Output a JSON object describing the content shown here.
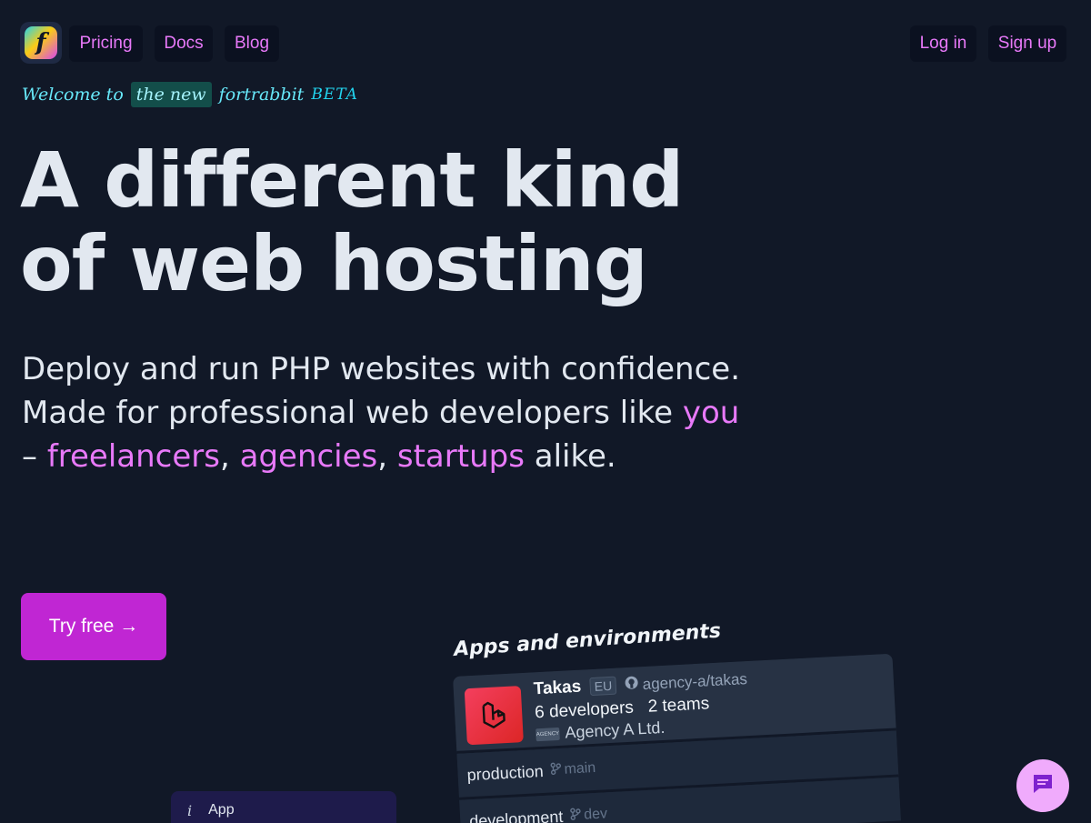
{
  "header": {
    "logo_letter": "f",
    "nav": [
      "Pricing",
      "Docs",
      "Blog"
    ],
    "login_label": "Log in",
    "signup_label": "Sign up"
  },
  "welcome": {
    "prefix": "Welcome to",
    "highlight": "the new",
    "brand": "fortrabbit",
    "badge": "BETA"
  },
  "hero": {
    "title_line1": "A different kind",
    "title_line2": "of web hosting",
    "subtitle_part1": "Deploy and run PHP websites with confidence. Made for professional web developers like ",
    "subtitle_you": "you",
    "subtitle_dash": " – ",
    "subtitle_freelancers": "freelancers",
    "subtitle_comma1": ", ",
    "subtitle_agencies": "agencies",
    "subtitle_comma2": ", ",
    "subtitle_startups": "startups",
    "subtitle_end": " alike.",
    "cta_label": "Try free →"
  },
  "apps_panel": {
    "title": "Apps and environments",
    "app": {
      "name": "Takas",
      "region": "EU",
      "repo": "agency-a/takas",
      "developers": "6 developers",
      "teams": "2 teams",
      "agency_logo_text": "AGENCY",
      "agency": "Agency A Ltd."
    },
    "environments": [
      {
        "name": "production",
        "branch": "main"
      },
      {
        "name": "development",
        "branch": "dev"
      }
    ]
  },
  "app_pill": {
    "icon_text": "i",
    "label": "App"
  },
  "colors": {
    "background": "#111827",
    "accent": "#e879f9",
    "cta": "#c026d3",
    "chat": "#f0abfc",
    "script": "#67e8f9"
  }
}
